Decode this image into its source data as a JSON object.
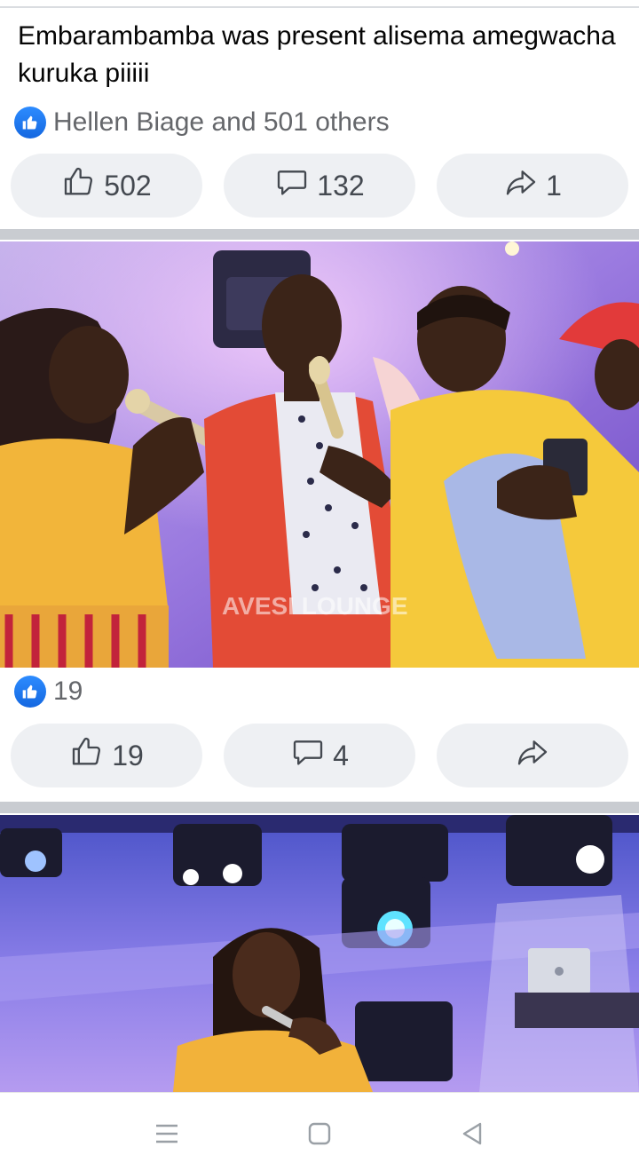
{
  "post": {
    "text": "Embarambamba was present alisema amegwacha kuruka piiiii",
    "reactions_summary": "Hellen Biage and 501 others",
    "like_count": "502",
    "comment_count": "132",
    "share_count": "1"
  },
  "photo1": {
    "reactions_count": "19",
    "like_count": "19",
    "comment_count": "4",
    "watermark": "AVESI LOUNGE"
  },
  "icons": [
    "like-badge-icon",
    "thumbs-up-icon",
    "comment-icon",
    "share-icon",
    "menu-icon",
    "home-square-icon",
    "back-triangle-icon"
  ],
  "colors": {
    "accent": "#1877f2",
    "button_bg": "#eef0f3",
    "divider": "#c9ccd1",
    "text_secondary": "#65676b"
  }
}
